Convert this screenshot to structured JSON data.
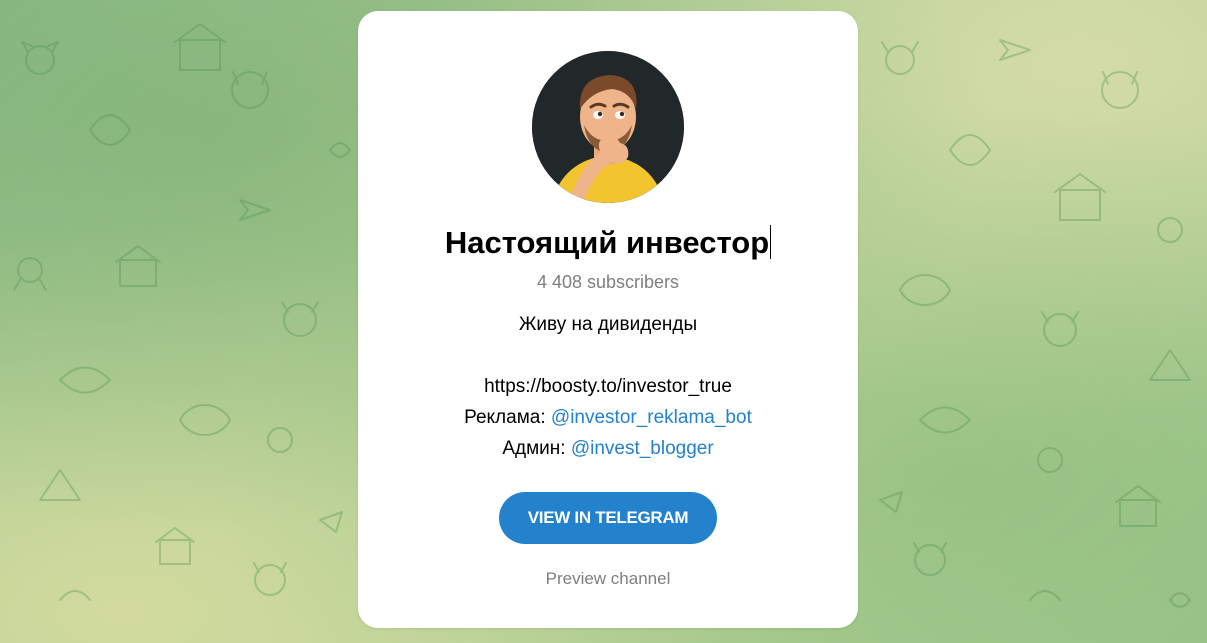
{
  "colors": {
    "accent": "#2481cc",
    "muted_text": "#7d7f81",
    "card_bg": "#ffffff"
  },
  "channel": {
    "avatar_icon": "channel-avatar-illustration",
    "title": "Настоящий инвестор",
    "subscribers": "4 408 subscribers",
    "description": {
      "line1": "Живу на дивиденды",
      "line2": "https://boosty.to/investor_true",
      "ad_label": "Реклама: ",
      "ad_link": "@investor_reklama_bot",
      "admin_label": "Админ: ",
      "admin_link": "@invest_blogger"
    }
  },
  "actions": {
    "view_button": "VIEW IN TELEGRAM",
    "preview_link": "Preview channel"
  }
}
